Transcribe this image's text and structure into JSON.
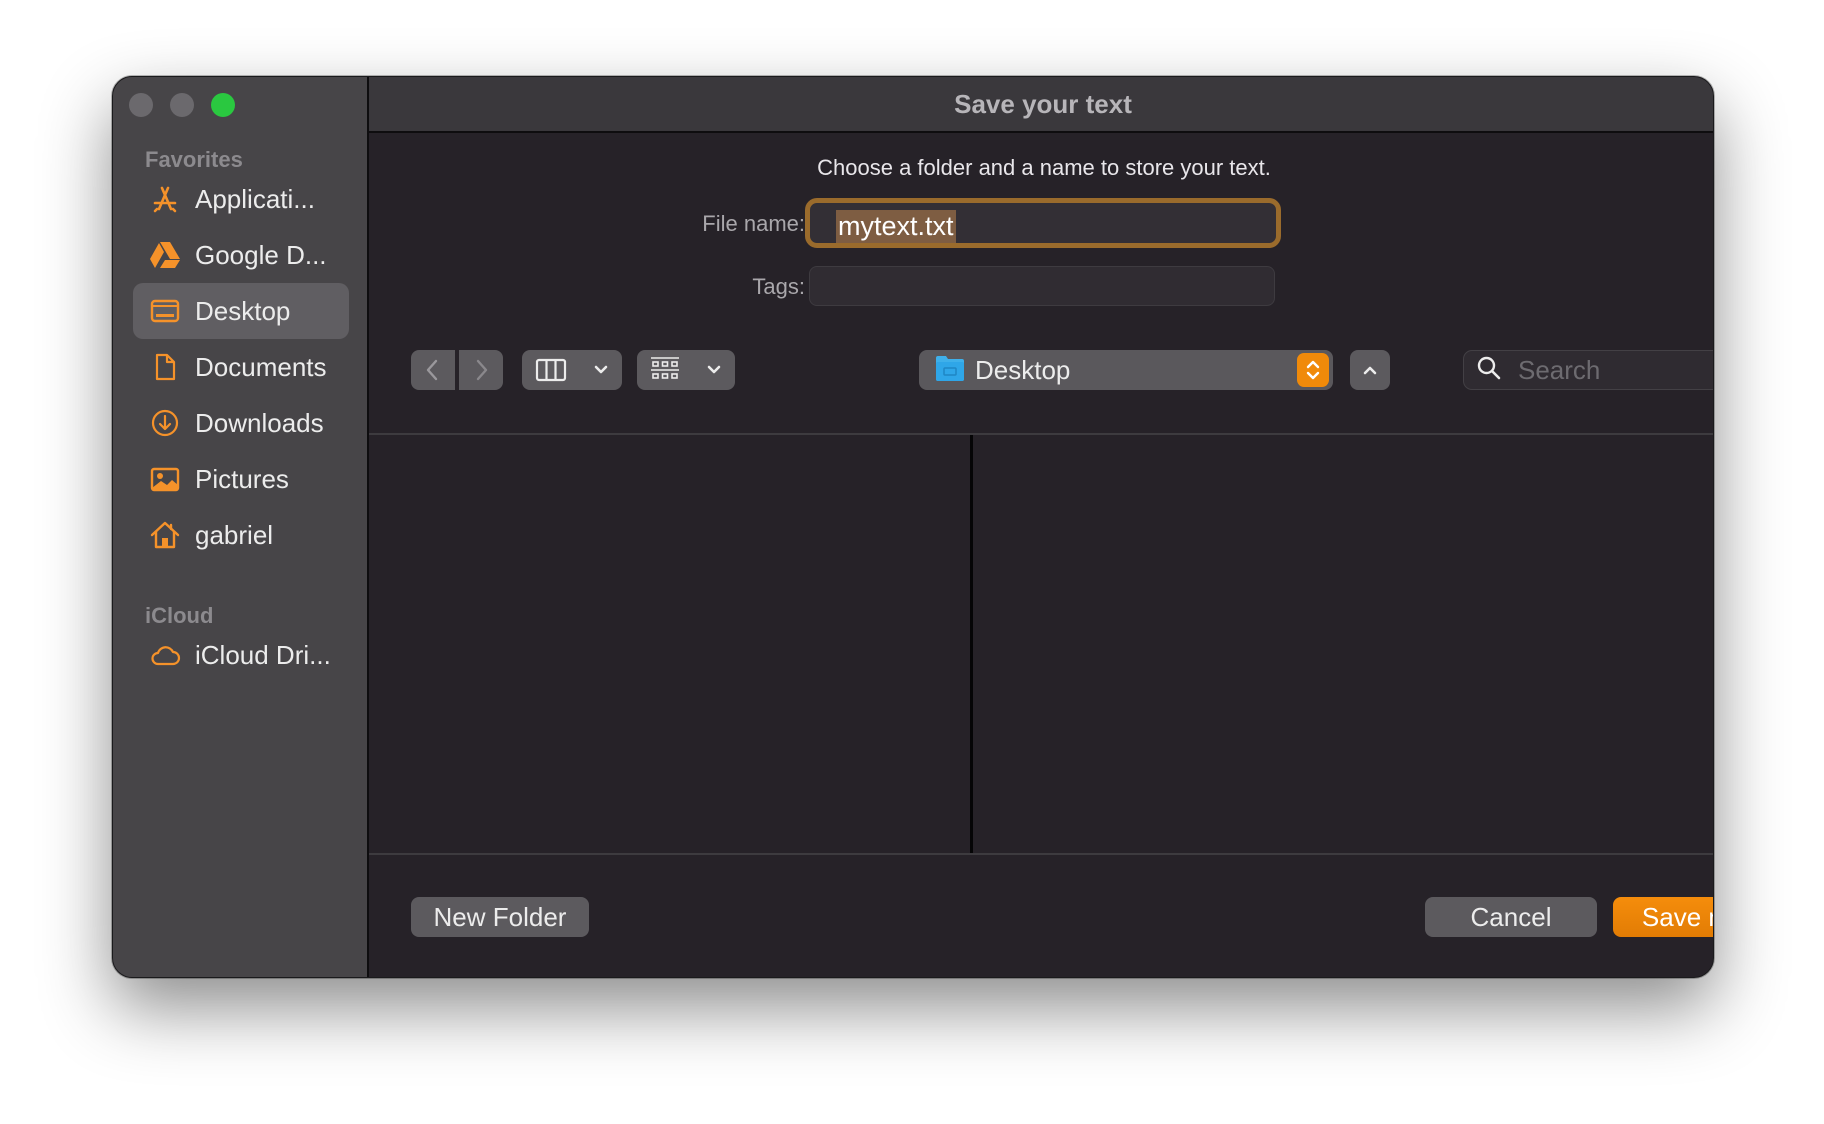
{
  "window": {
    "title": "Save your text",
    "traffic_lights": [
      "close",
      "minimize",
      "zoom"
    ]
  },
  "sidebar": {
    "sections": [
      {
        "label": "Favorites",
        "items": [
          {
            "label": "Applicati...",
            "icon": "applications-icon",
            "selected": false
          },
          {
            "label": "Google D...",
            "icon": "google-drive-icon",
            "selected": false
          },
          {
            "label": "Desktop",
            "icon": "desktop-icon",
            "selected": true
          },
          {
            "label": "Documents",
            "icon": "document-icon",
            "selected": false
          },
          {
            "label": "Downloads",
            "icon": "download-icon",
            "selected": false
          },
          {
            "label": "Pictures",
            "icon": "pictures-icon",
            "selected": false
          },
          {
            "label": "gabriel",
            "icon": "home-icon",
            "selected": false
          }
        ]
      },
      {
        "label": "iCloud",
        "items": [
          {
            "label": "iCloud Dri...",
            "icon": "cloud-icon",
            "selected": false
          }
        ]
      }
    ]
  },
  "form": {
    "prompt": "Choose a folder and a name to store your text.",
    "filename_label": "File name:",
    "filename_value": "mytext.txt",
    "tags_label": "Tags:",
    "tags_value": ""
  },
  "toolbar": {
    "back_icon": "chevron-left-icon",
    "forward_icon": "chevron-right-icon",
    "view_mode_icon": "columns-icon",
    "group_icon": "grid-icon",
    "location": "Desktop",
    "search_placeholder": "Search"
  },
  "footer": {
    "new_folder": "New Folder",
    "cancel": "Cancel",
    "save": "Save now"
  },
  "colors": {
    "accent": "#f08a0a",
    "focus_ring": "#9a6b2c",
    "selection": "#7e5d42",
    "zoom_light": "#2ac840"
  }
}
